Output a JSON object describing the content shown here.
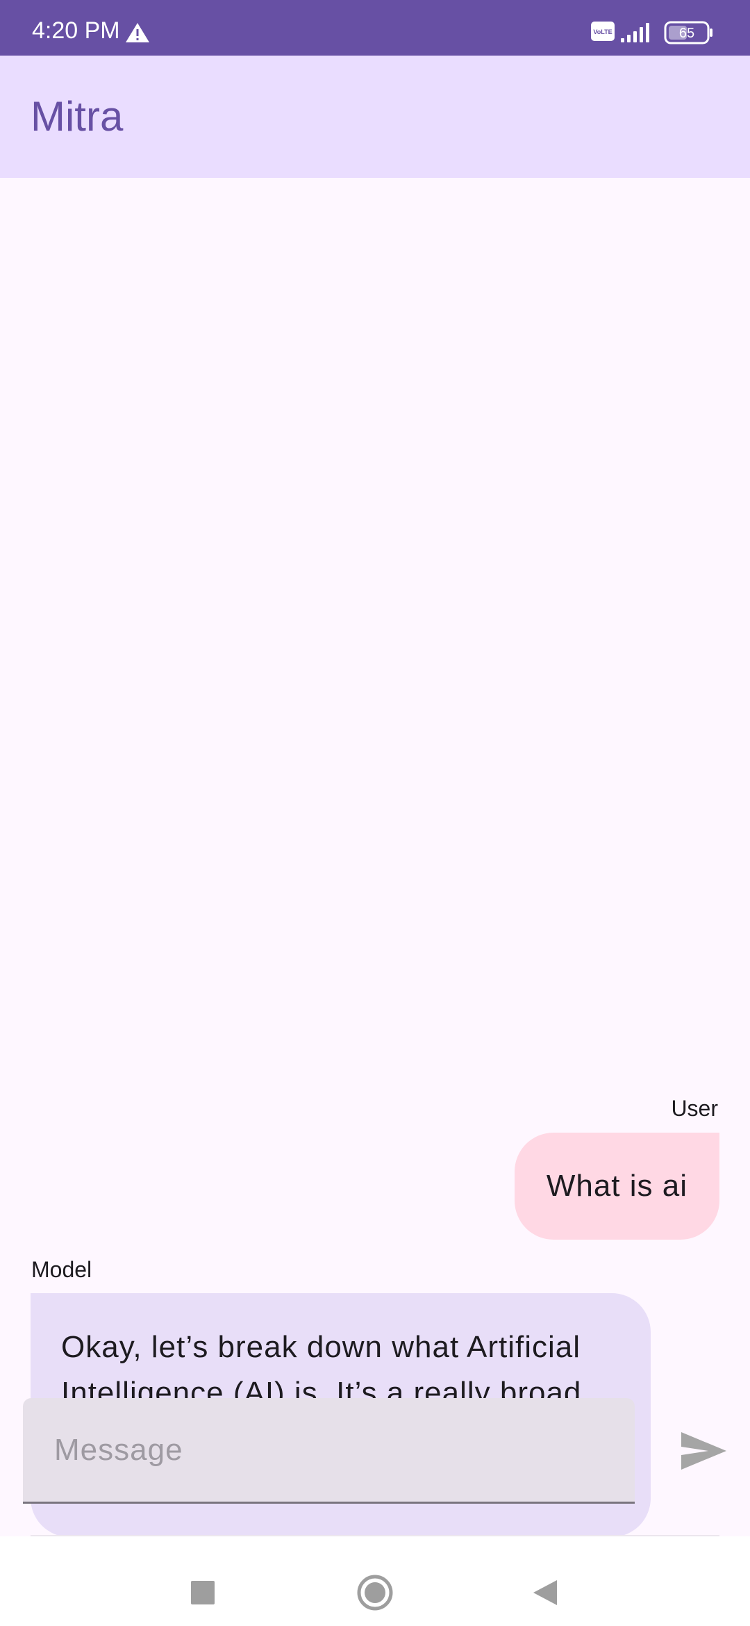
{
  "status_bar": {
    "time": "4:20 PM",
    "warning_icon": "warning-icon",
    "network_badge": "VoLTE",
    "signal_icon": "signal-icon",
    "battery_level": "65"
  },
  "app_bar": {
    "title": "Mitra"
  },
  "chat": {
    "messages": [
      {
        "sender": "User",
        "text": "What is ai"
      },
      {
        "sender": "Model",
        "text": "Okay, let’s break down what Artificial Intelligence (AI) is. It’s a really broad and rapidly evolving field, so here’s a layered explanation"
      }
    ]
  },
  "composer": {
    "placeholder": "Message",
    "value": "",
    "send_icon": "send-icon"
  },
  "nav_bar": {
    "recents_icon": "recents-icon",
    "home_icon": "home-icon",
    "back_icon": "back-icon"
  },
  "colors": {
    "primary": "#6750A4",
    "app_bar_background": "#EADDFF",
    "user_bubble": "#FFD8E4",
    "model_bubble": "#E8DEF8",
    "input_background": "#E6E0E9"
  }
}
